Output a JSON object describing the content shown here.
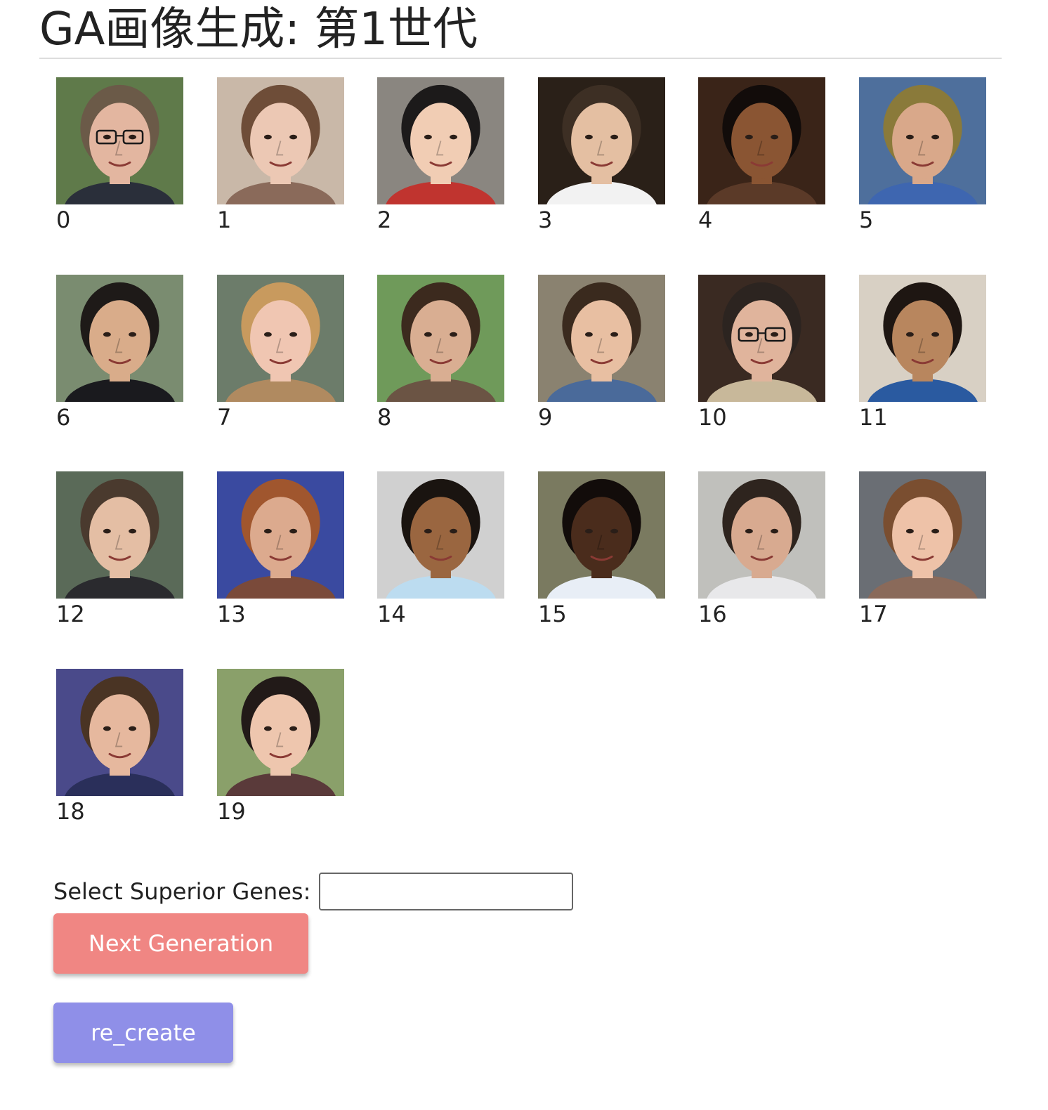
{
  "header": {
    "title": "GA画像生成: 第1世代"
  },
  "gallery": {
    "items": [
      {
        "index": "0",
        "palette": {
          "bg": "#5f7a4a",
          "skin": "#e3b6a0",
          "hair": "#6b5a48",
          "shirt": "#2a2f3a"
        },
        "glasses": true
      },
      {
        "index": "1",
        "palette": {
          "bg": "#c9b8a8",
          "skin": "#ecc8b4",
          "hair": "#6e4d38",
          "shirt": "#8a6a5a"
        },
        "glasses": false
      },
      {
        "index": "2",
        "palette": {
          "bg": "#8a8680",
          "skin": "#f1cdb4",
          "hair": "#1c1a1a",
          "shirt": "#c0342f"
        },
        "glasses": false
      },
      {
        "index": "3",
        "palette": {
          "bg": "#2a2018",
          "skin": "#e4bfa2",
          "hair": "#3d2f24",
          "shirt": "#f2f2f2"
        },
        "glasses": false
      },
      {
        "index": "4",
        "palette": {
          "bg": "#3a2418",
          "skin": "#8a5533",
          "hair": "#120c0a",
          "shirt": "#5b3a28"
        },
        "glasses": false
      },
      {
        "index": "5",
        "palette": {
          "bg": "#4e6f9c",
          "skin": "#d9a88a",
          "hair": "#8a7a3a",
          "shirt": "#3e66b0"
        },
        "glasses": false
      },
      {
        "index": "6",
        "palette": {
          "bg": "#7a8c70",
          "skin": "#d9ac8a",
          "hair": "#1e1a18",
          "shirt": "#1a1a1e"
        },
        "glasses": false
      },
      {
        "index": "7",
        "palette": {
          "bg": "#6c7c6a",
          "skin": "#f0c6b2",
          "hair": "#c89a5e",
          "shirt": "#b08a60"
        },
        "glasses": false
      },
      {
        "index": "8",
        "palette": {
          "bg": "#6f9a5a",
          "skin": "#d9ae92",
          "hair": "#3c2a1e",
          "shirt": "#6b5444"
        },
        "glasses": false
      },
      {
        "index": "9",
        "palette": {
          "bg": "#8a8270",
          "skin": "#e8bfa2",
          "hair": "#3a2a1e",
          "shirt": "#4a6a9a"
        },
        "glasses": false
      },
      {
        "index": "10",
        "palette": {
          "bg": "#3a2a22",
          "skin": "#e0b49c",
          "hair": "#2c2420",
          "shirt": "#c8b89a"
        },
        "glasses": true
      },
      {
        "index": "11",
        "palette": {
          "bg": "#d8d0c4",
          "skin": "#b8865e",
          "hair": "#1e1612",
          "shirt": "#2a5aa0"
        },
        "glasses": false
      },
      {
        "index": "12",
        "palette": {
          "bg": "#5a6a58",
          "skin": "#e4bea4",
          "hair": "#4a3a2e",
          "shirt": "#2a2a2e"
        },
        "glasses": false
      },
      {
        "index": "13",
        "palette": {
          "bg": "#3a4aa0",
          "skin": "#dcaa8e",
          "hair": "#a0562e",
          "shirt": "#7a4a3a"
        },
        "glasses": false
      },
      {
        "index": "14",
        "palette": {
          "bg": "#d0d0d0",
          "skin": "#9a6640",
          "hair": "#1a1410",
          "shirt": "#bcdcf0"
        },
        "glasses": false
      },
      {
        "index": "15",
        "palette": {
          "bg": "#7a7a60",
          "skin": "#4a2c1c",
          "hair": "#120c0a",
          "shirt": "#e8eef6"
        },
        "glasses": false
      },
      {
        "index": "16",
        "palette": {
          "bg": "#c0c0bc",
          "skin": "#d8aa90",
          "hair": "#2e241e",
          "shirt": "#e8e8ea"
        },
        "glasses": false
      },
      {
        "index": "17",
        "palette": {
          "bg": "#6a6e74",
          "skin": "#eec2a8",
          "hair": "#7a4e30",
          "shirt": "#8a6a5a"
        },
        "glasses": false
      },
      {
        "index": "18",
        "palette": {
          "bg": "#4a4a8a",
          "skin": "#e6b89e",
          "hair": "#4a3424",
          "shirt": "#2a2f5a"
        },
        "glasses": false
      },
      {
        "index": "19",
        "palette": {
          "bg": "#8aa06a",
          "skin": "#eec6ae",
          "hair": "#221a18",
          "shirt": "#5a3a3a"
        },
        "glasses": false
      }
    ]
  },
  "form": {
    "genes_label": "Select Superior Genes:",
    "genes_value": "",
    "genes_placeholder": ""
  },
  "buttons": {
    "next_label": "Next Generation",
    "recreate_label": "re_create"
  },
  "colors": {
    "next_button": "#f08683",
    "recreate_button": "#8f8fe8",
    "rule": "#dddddd"
  }
}
